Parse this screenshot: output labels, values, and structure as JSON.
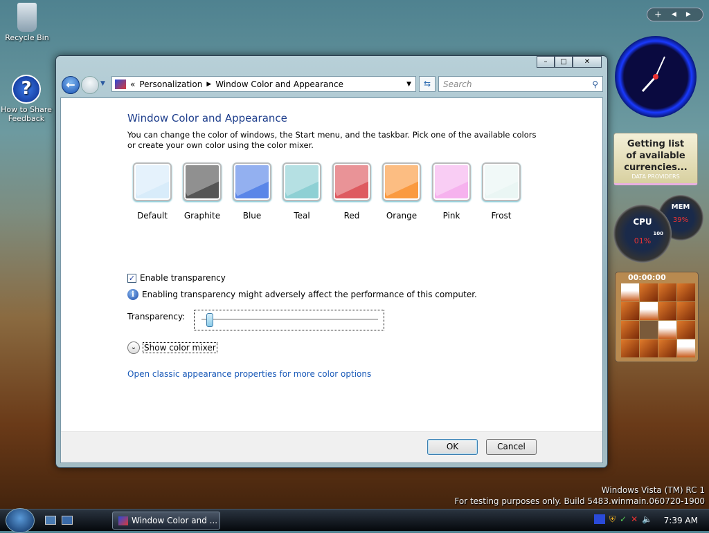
{
  "desktop": {
    "icons": [
      {
        "label": "Recycle Bin",
        "icon": "recycle-bin-icon"
      },
      {
        "label": "How to Share Feedback",
        "icon": "help-icon"
      }
    ]
  },
  "window": {
    "address": {
      "overflow": "«",
      "crumbs": [
        "Personalization",
        "Window Color and Appearance"
      ]
    },
    "search_placeholder": "Search",
    "title": "Window Color and Appearance",
    "description": "You can change the color of windows, the Start menu, and the taskbar. Pick one of the available colors or create your own color using the color mixer.",
    "swatches": [
      {
        "label": "Default",
        "color": "#d8ecfa"
      },
      {
        "label": "Graphite",
        "color": "#555555"
      },
      {
        "label": "Blue",
        "color": "#5a86e8"
      },
      {
        "label": "Teal",
        "color": "#8ed0d4"
      },
      {
        "label": "Red",
        "color": "#de5a60"
      },
      {
        "label": "Orange",
        "color": "#fa9a40"
      },
      {
        "label": "Pink",
        "color": "#f6b2ee"
      },
      {
        "label": "Frost",
        "color": "#eaf6f4"
      }
    ],
    "enable_transparency": {
      "label": "Enable transparency",
      "checked": true
    },
    "info_text": "Enabling transparency might adversely affect the performance of this computer.",
    "transparency_label": "Transparency:",
    "transparency_percent": 5,
    "color_mixer_label": "Show color mixer",
    "classic_link": "Open classic appearance properties for more color options",
    "ok": "OK",
    "cancel": "Cancel"
  },
  "gadgets": {
    "currency": {
      "text": "Getting list of available currencies...",
      "provider": "DATA PROVIDERS"
    },
    "cpu": {
      "label": "CPU",
      "value": "01%",
      "max": "100"
    },
    "mem": {
      "label": "MEM",
      "value": "39%"
    },
    "puzzle": {
      "timer": "00:00:00"
    }
  },
  "watermark": {
    "line1": "Windows Vista (TM) RC 1",
    "line2": "For testing purposes only. Build 5483.winmain.060720-1900"
  },
  "taskbar": {
    "task": "Window Color and ...",
    "time": "7:39 AM"
  }
}
